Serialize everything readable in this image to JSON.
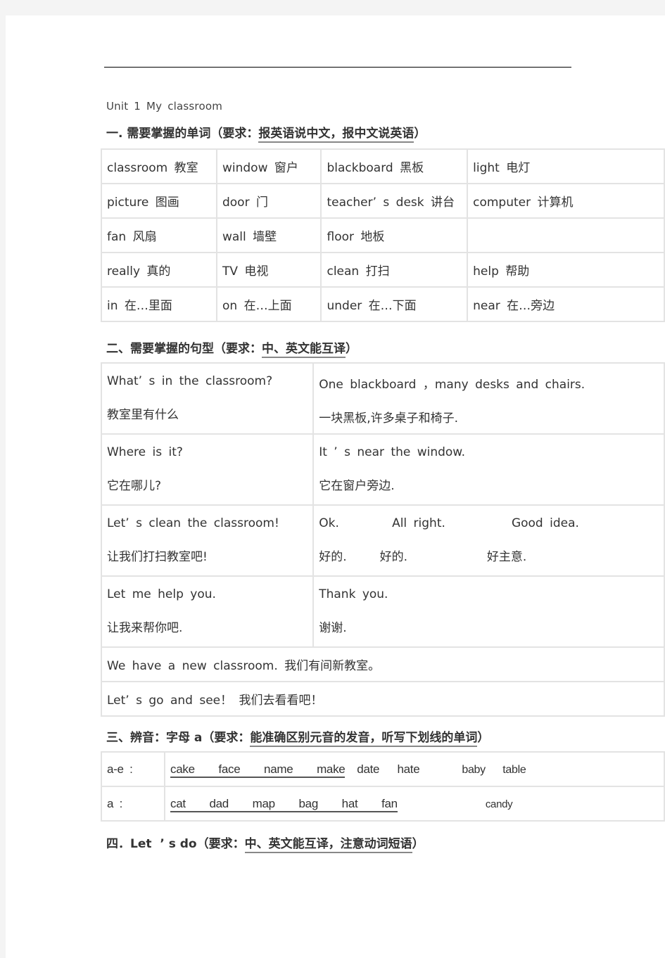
{
  "unit_title": "Unit  1  My  classroom",
  "sections": {
    "s1": {
      "title": "一. 需要掌握的单词（要求：",
      "requirement": "报英语说中文，报中文说英语",
      "close": "）"
    },
    "s2": {
      "title": "二、需要掌握的句型（要求：",
      "requirement": "中、英文能互译",
      "close": "）"
    },
    "s3": {
      "title": "三、辨音：字母 a（要求：",
      "requirement": "能准确区别元音的发音，听写下划线的单词",
      "close": "）"
    },
    "s4": {
      "title": "四．Let  ’ s do（要求：",
      "requirement": "中、英文能互译，注意动词短语",
      "close": "）"
    }
  },
  "vocab": [
    [
      "classroom  教室",
      "window   窗户",
      "blackboard   黑板",
      "light   电灯"
    ],
    [
      "picture  图画",
      "door  门",
      "teacher’ s  desk  讲台",
      "computer  计算机"
    ],
    [
      "fan  风扇",
      "wall   墙壁",
      "floor   地板",
      ""
    ],
    [
      "really   真的",
      "TV  电视",
      "clean  打扫",
      "help   帮助"
    ],
    [
      "in  在…里面",
      "on  在…上面",
      "under  在…下面",
      "near  在…旁边"
    ]
  ],
  "sentences": [
    {
      "q_en": "What’ s  in  the  classroom?",
      "q_cn": "教室里有什么",
      "a_en": "One  blackboard ，many  desks  and  chairs.",
      "a_cn": "一块黑板,许多桌子和椅子."
    },
    {
      "q_en": "Where  is  it?",
      "q_cn": "它在哪儿?",
      "a_en": "It  ’  s  near  the  window.",
      "a_cn": "它在窗户旁边."
    },
    {
      "q_en": "Let’ s  clean  the  classroom!",
      "q_cn": "让我们打扫教室吧!",
      "a_en": "Ok.        All right.          Good idea.",
      "a_cn": "好的.     好的.            好主意."
    },
    {
      "q_en": "Let  me  help  you.",
      "q_cn": "让我来帮你吧.",
      "a_en": "Thank  you.",
      "a_cn": "谢谢."
    }
  ],
  "sentence_singles": [
    "We  have  a  new  classroom.  我们有间新教室。",
    "Let’ s  go  and  see！  我们去看看吧！"
  ],
  "phonics": [
    {
      "label": "a-e :",
      "underlined": "cake    face    name    make",
      "rest": "  date   hate",
      "extra": "baby   table"
    },
    {
      "label": "a :",
      "underlined": "cat    dad    map    bag    hat    fan",
      "rest": "",
      "extra": "candy"
    }
  ]
}
